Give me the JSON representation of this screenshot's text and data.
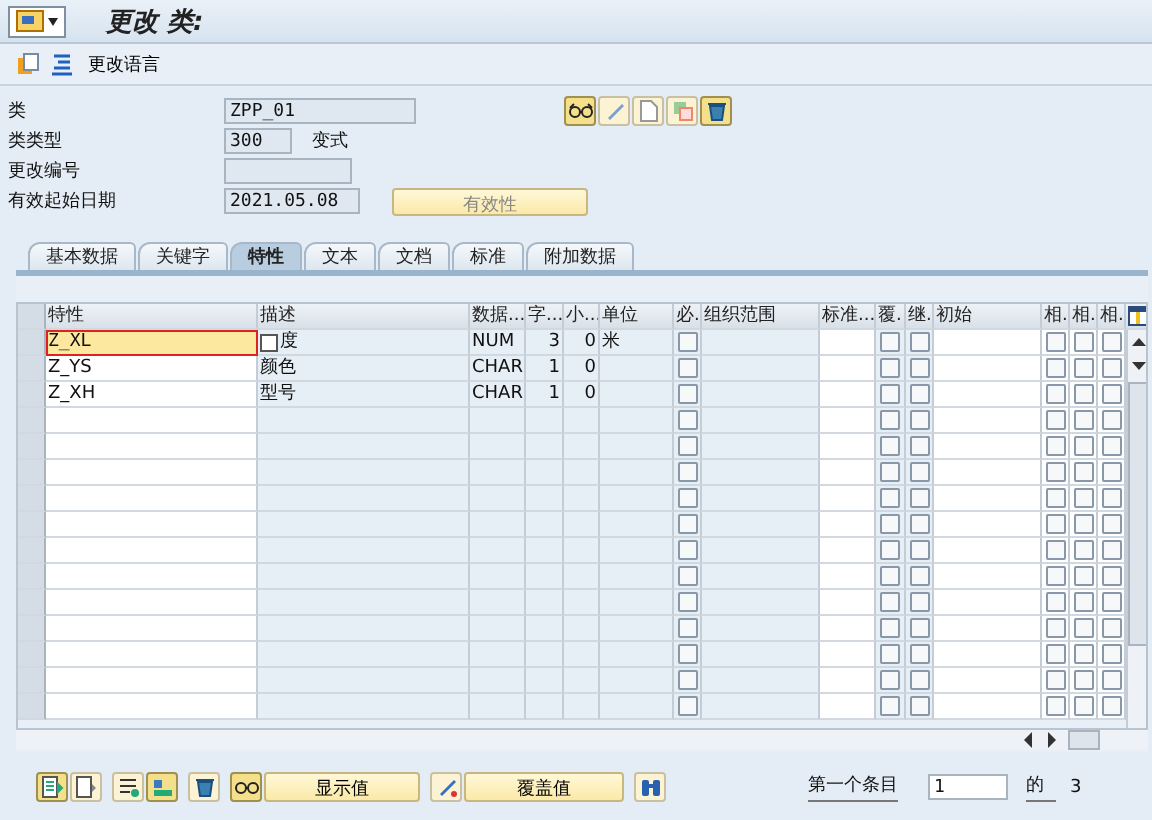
{
  "title": "更改 类:",
  "toolbar": {
    "button": "更改语言"
  },
  "form": [
    {
      "label": "类",
      "value": "ZPP_01"
    },
    {
      "label": "类类型",
      "value": "300",
      "note": "变式"
    },
    {
      "label": "更改编号"
    },
    {
      "label": "有效起始日期",
      "value": "2021.05.08",
      "button": "有效性"
    }
  ],
  "tabs": [
    {
      "label": "基本数据",
      "selected": false
    },
    {
      "label": "关键字",
      "selected": false
    },
    {
      "label": "特性",
      "selected": true
    },
    {
      "label": "文本",
      "selected": false
    },
    {
      "label": "文档",
      "selected": false
    },
    {
      "label": "标准",
      "selected": false
    },
    {
      "label": "附加数据",
      "selected": false
    }
  ],
  "table": {
    "columns": [
      "特性",
      "描述",
      "数据...",
      "字...",
      "小...",
      "单位",
      "必.",
      "组织范围",
      "标准...",
      "覆.",
      "继.",
      "初始",
      "相.",
      "相.",
      "相."
    ],
    "rows": [
      {
        "selected": true,
        "name": "Z_XL",
        "desc": "度",
        "dtype": "NUM",
        "chars": "3",
        "decimals": "0",
        "unit": "米",
        "required": false,
        "overwrite": false,
        "inherit": false,
        "rel": [
          false,
          false,
          false
        ]
      },
      {
        "selected": false,
        "name": "Z_YS",
        "desc": "颜色",
        "dtype": "CHAR",
        "chars": "1",
        "decimals": "0",
        "required": false,
        "overwrite": false,
        "inherit": false,
        "rel": [
          false,
          false,
          false
        ]
      },
      {
        "selected": false,
        "name": "Z_XH",
        "desc": "型号",
        "dtype": "CHAR",
        "chars": "1",
        "decimals": "0",
        "required": false,
        "overwrite": false,
        "inherit": false,
        "rel": [
          false,
          false,
          false
        ]
      },
      {
        "selected": false,
        "required": false,
        "overwrite": false,
        "inherit": false,
        "rel": [
          false,
          false,
          false
        ]
      },
      {
        "selected": false,
        "required": false,
        "overwrite": false,
        "inherit": false,
        "rel": [
          false,
          false,
          false
        ]
      },
      {
        "selected": false,
        "required": false,
        "overwrite": false,
        "inherit": false,
        "rel": [
          false,
          false,
          false
        ]
      },
      {
        "selected": false,
        "required": false,
        "overwrite": false,
        "inherit": false,
        "rel": [
          false,
          false,
          false
        ]
      },
      {
        "selected": false,
        "required": false,
        "overwrite": false,
        "inherit": false,
        "rel": [
          false,
          false,
          false
        ]
      },
      {
        "selected": false,
        "required": false,
        "overwrite": false,
        "inherit": false,
        "rel": [
          false,
          false,
          false
        ]
      },
      {
        "selected": false,
        "required": false,
        "overwrite": false,
        "inherit": false,
        "rel": [
          false,
          false,
          false
        ]
      },
      {
        "selected": false,
        "required": false,
        "overwrite": false,
        "inherit": false,
        "rel": [
          false,
          false,
          false
        ]
      },
      {
        "selected": false,
        "required": false,
        "overwrite": false,
        "inherit": false,
        "rel": [
          false,
          false,
          false
        ]
      },
      {
        "selected": false,
        "required": false,
        "overwrite": false,
        "inherit": false,
        "rel": [
          false,
          false,
          false
        ]
      },
      {
        "selected": false,
        "required": false,
        "overwrite": false,
        "inherit": false,
        "rel": [
          false,
          false,
          false
        ]
      },
      {
        "selected": false,
        "required": false,
        "overwrite": false,
        "inherit": false,
        "rel": [
          false,
          false,
          false
        ]
      }
    ]
  },
  "bottom": {
    "show_button": "显示值",
    "overwrite_button": "覆盖值",
    "entry_label": "第一个条目",
    "entry_value": "1",
    "of": "的",
    "total": "3"
  }
}
